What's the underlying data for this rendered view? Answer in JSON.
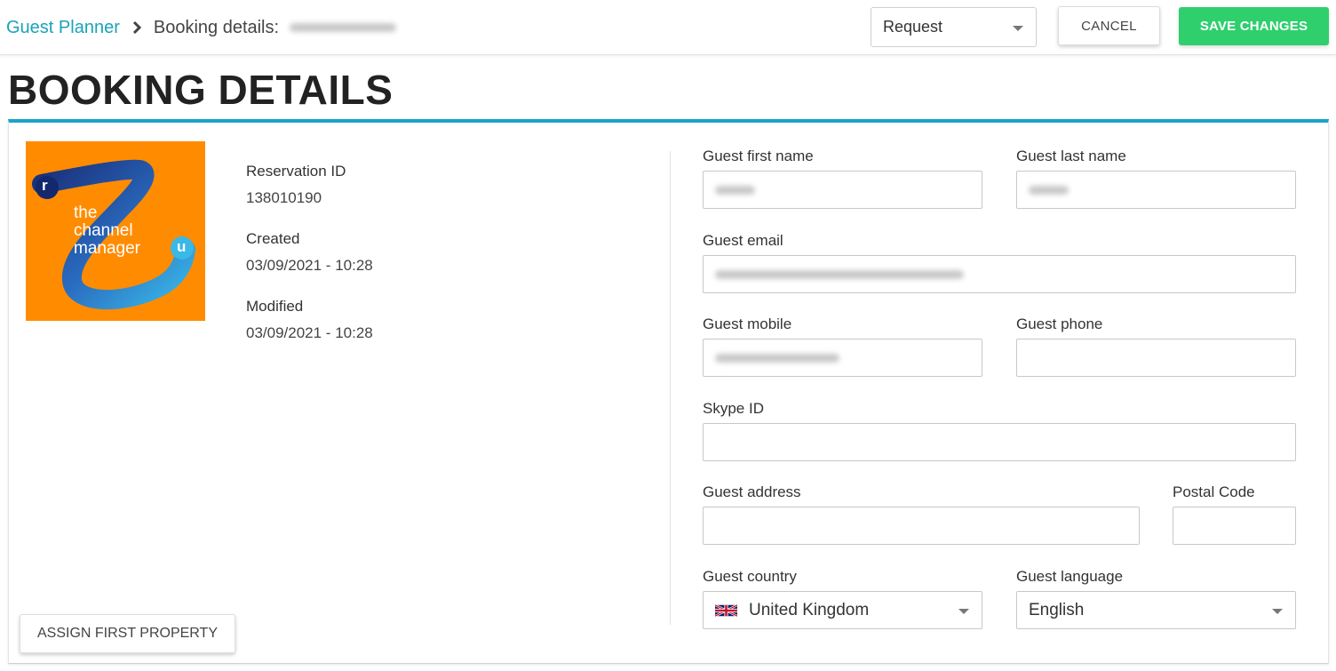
{
  "breadcrumb": {
    "root": "Guest Planner",
    "separator_icon": "chevron-right-icon",
    "current": "Booking details:"
  },
  "header": {
    "status_select": {
      "value": "Request"
    },
    "cancel_label": "CANCEL",
    "save_label": "SAVE CHANGES"
  },
  "page_title": "BOOKING DETAILS",
  "logo": {
    "badge_left": "r",
    "badge_right": "u",
    "lines": [
      "the",
      "channel",
      "manager"
    ]
  },
  "meta": {
    "reservation_id_label": "Reservation ID",
    "reservation_id": "138010190",
    "created_label": "Created",
    "created": "03/09/2021 - 10:28",
    "modified_label": "Modified",
    "modified": "03/09/2021 - 10:28"
  },
  "form": {
    "first_name_label": "Guest first name",
    "last_name_label": "Guest last name",
    "email_label": "Guest email",
    "mobile_label": "Guest mobile",
    "phone_label": "Guest phone",
    "skype_label": "Skype ID",
    "address_label": "Guest address",
    "postal_label": "Postal Code",
    "country_label": "Guest country",
    "country_value": "United Kingdom",
    "language_label": "Guest language",
    "language_value": "English"
  },
  "assign_label": "ASSIGN FIRST PROPERTY",
  "colors": {
    "accent": "#1aa3b8",
    "save": "#2fcf6e",
    "logo_bg": "#ff8c00"
  }
}
